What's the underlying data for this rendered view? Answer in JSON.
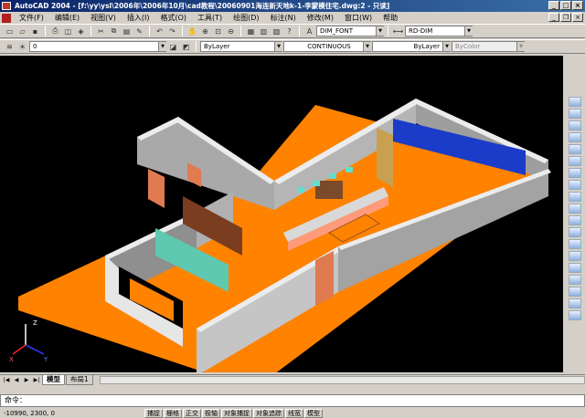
{
  "window": {
    "title": "AutoCAD 2004 - [f:\\yy\\ysl\\2006年\\2006年10月\\cad教程\\20060901海连新天地k-1-李蒙模住宅.dwg:2 - 只读]"
  },
  "menubar": {
    "items": [
      "文件(F)",
      "编辑(E)",
      "视图(V)",
      "插入(I)",
      "格式(O)",
      "工具(T)",
      "绘图(D)",
      "标注(N)",
      "修改(M)",
      "窗口(W)",
      "帮助"
    ]
  },
  "toolbar1": {
    "text_style": "DIM_FONT",
    "dim_style": "RD-DIM"
  },
  "toolbar2": {
    "layer": "0",
    "color": "ByLayer",
    "linetype": "CONTINUOUS",
    "lineweight": "ByLayer",
    "plotstyle": "ByColor"
  },
  "tabs": {
    "items": [
      "模型",
      "布局1"
    ],
    "active": "模型"
  },
  "command": {
    "prompt": "命令："
  },
  "status": {
    "coords": "-10990, 2300, 0",
    "buttons": [
      "捕捉",
      "栅格",
      "正交",
      "极轴",
      "对象捕捉",
      "对象追踪",
      "线宽",
      "模型"
    ]
  },
  "colors": {
    "floor": "#ff8200",
    "wall": "#a9a9a9",
    "wall_top": "#ececec",
    "viewport_bg": "#000000",
    "glass": "#1a3cc8"
  }
}
